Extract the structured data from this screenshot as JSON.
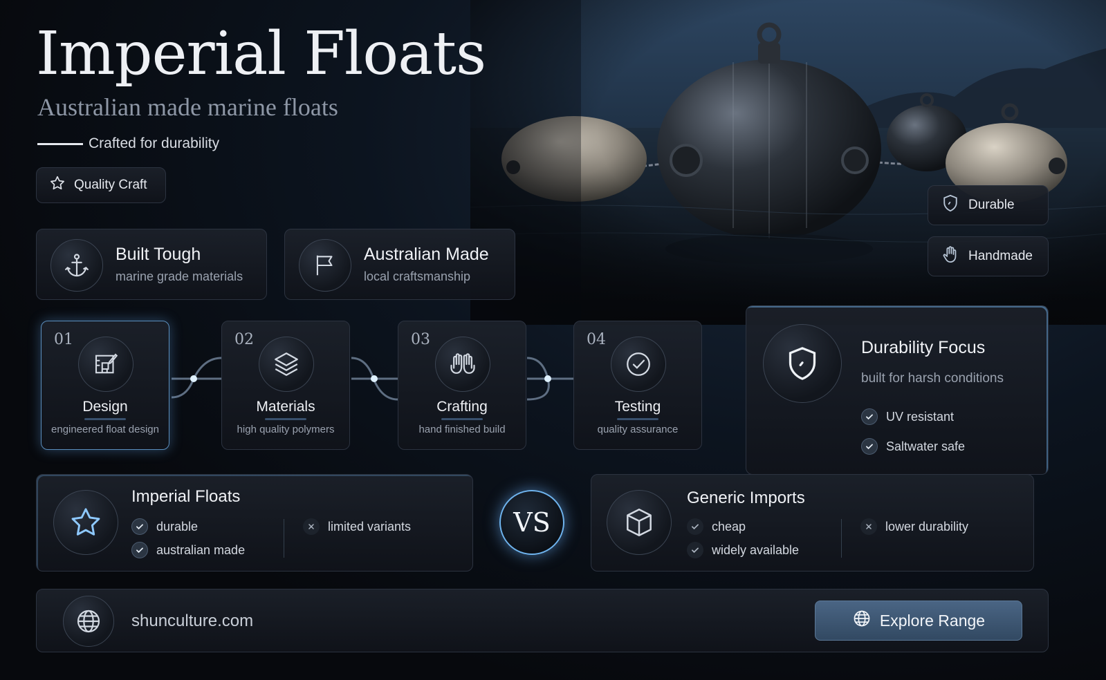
{
  "header": {
    "title": "Imperial Floats",
    "subtitle": "Australian made marine floats",
    "tagline": "Crafted for durability",
    "badge": {
      "label": "Quality Craft",
      "icon": "star-icon"
    }
  },
  "side_badges": [
    {
      "label": "Durable",
      "icon": "shield-icon"
    },
    {
      "label": "Handmade",
      "icon": "hand-icon"
    }
  ],
  "features": [
    {
      "title": "Built Tough",
      "sub": "marine grade materials",
      "icon": "anchor-icon"
    },
    {
      "title": "Australian Made",
      "sub": "local craftsmanship",
      "icon": "flag-icon"
    }
  ],
  "steps": [
    {
      "num": "01",
      "title": "Design",
      "sub": "engineered float design",
      "icon": "blueprint-icon"
    },
    {
      "num": "02",
      "title": "Materials",
      "sub": "high quality polymers",
      "icon": "layers-icon"
    },
    {
      "num": "03",
      "title": "Crafting",
      "sub": "hand finished build",
      "icon": "hands-icon"
    },
    {
      "num": "04",
      "title": "Testing",
      "sub": "quality assurance",
      "icon": "check-circle-icon"
    }
  ],
  "durability": {
    "title": "Durability Focus",
    "sub": "built for harsh conditions",
    "items": [
      "UV resistant",
      "Saltwater safe"
    ],
    "icon": "shield-icon"
  },
  "comparison": {
    "vs_label": "VS",
    "left": {
      "title": "Imperial Floats",
      "icon": "star-icon",
      "pros": [
        "durable",
        "australian made"
      ],
      "cons": [
        "limited variants"
      ]
    },
    "right": {
      "title": "Generic Imports",
      "icon": "box-icon",
      "pros": [
        "cheap",
        "widely available"
      ],
      "cons": [
        "lower durability"
      ]
    }
  },
  "footer": {
    "website": "shunculture.com",
    "cta_label": "Explore Range",
    "icon": "globe-icon"
  },
  "colors": {
    "accent": "#7fc4ff",
    "button": "#3e5874",
    "background": "#07090d"
  }
}
